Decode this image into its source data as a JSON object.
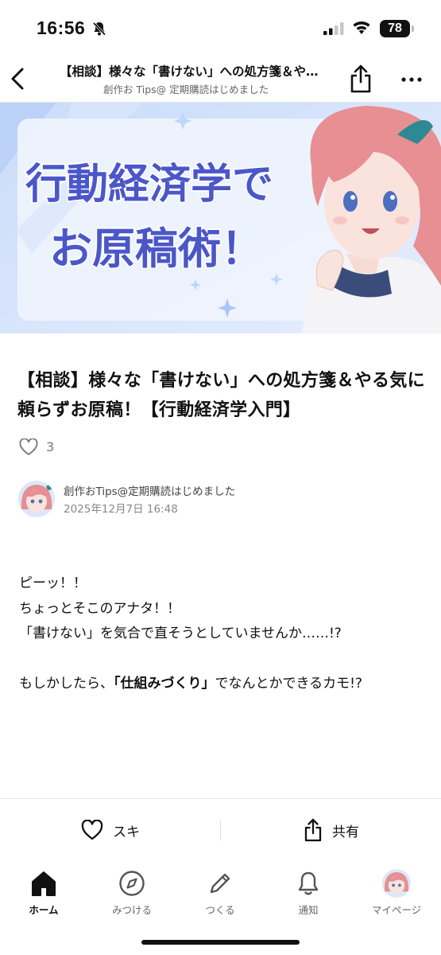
{
  "status_bar": {
    "time": "16:56",
    "battery": "78"
  },
  "nav": {
    "title": "【相談】様々な「書けない」への処方箋＆やる気に頼らずお原稿！【行動経済学入門】",
    "subtitle": "創作お Tips@ 定期購読はじめました"
  },
  "hero": {
    "line1": "行動経済学で",
    "line2": "お原稿術！"
  },
  "article": {
    "title": "【相談】様々な「書けない」への処方箋＆やる気に頼らずお原稿！【行動経済学入門】",
    "like_count": "3",
    "author": "創作おTips@定期購読はじめました",
    "date": "2025年12月7日 16:48",
    "body": {
      "p1": "ピーッ！！",
      "p2": "ちょっとそこのアナタ！！",
      "p3": "「書けない」を気合で直そうとしていませんか……!?",
      "p4_before": "もしかしたら、",
      "p4_bold": "「仕組みづくり」",
      "p4_after": "でなんとかできるカモ!?"
    }
  },
  "actions": {
    "like_label": "スキ",
    "share_label": "共有"
  },
  "tabs": [
    {
      "label": "ホーム",
      "icon": "home-icon"
    },
    {
      "label": "みつける",
      "icon": "compass-icon"
    },
    {
      "label": "つくる",
      "icon": "pencil-icon"
    },
    {
      "label": "通知",
      "icon": "bell-icon"
    },
    {
      "label": "マイページ",
      "icon": "avatar"
    }
  ],
  "colors": {
    "accent_text": "#4b57c8",
    "banner_bg": "#dbe7fb",
    "hair": "#e78f92"
  }
}
